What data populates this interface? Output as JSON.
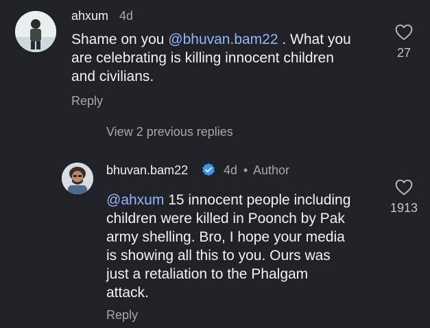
{
  "comment": {
    "username": "ahxum",
    "time": "4d",
    "text_before_mention": "Shame on you ",
    "mention": "@bhuvan.bam22",
    "line1_rest": " . What you",
    "line2": "are celebrating is killing innocent children",
    "line3": "and civilians.",
    "likes": "27",
    "reply_label": "Reply"
  },
  "view_replies_label": "View 2 previous replies",
  "reply": {
    "username": "bhuvan.bam22",
    "time": "4d",
    "separator": "•",
    "badge": "Author",
    "mention": "@ahxum",
    "line1_rest": " 15 innocent people including",
    "line2": "children were killed in Poonch by Pak",
    "line3": "army shelling. Bro, I hope your media",
    "line4": "is showing all this to you. Ours was",
    "line5": "just a retaliation to the Phalgam",
    "line6": "attack.",
    "likes": "1913",
    "reply_label": "Reply"
  },
  "colors": {
    "background": "#212227",
    "mention": "#8fb8ff",
    "secondary_text": "#a6a8ae",
    "verified_badge": "#3897f0"
  },
  "icons": {
    "like": "heart-outline-icon",
    "verified": "verified-badge-icon"
  }
}
